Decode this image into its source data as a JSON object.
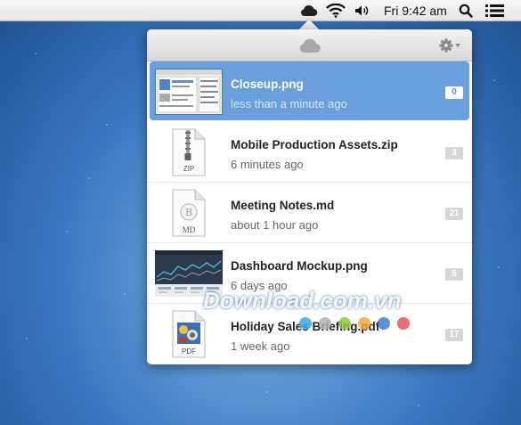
{
  "menubar": {
    "clock": "Fri 9:42 am",
    "icons": [
      "cloud-icon",
      "wifi-icon",
      "volume-icon",
      "search-icon",
      "list-icon"
    ]
  },
  "popover": {
    "header_icons": [
      "cloud-icon",
      "gear-icon"
    ],
    "files": [
      {
        "name": "Closeup.png",
        "time": "less than a minute ago",
        "count": "0",
        "selected": true,
        "thumb": "screenshot"
      },
      {
        "name": "Mobile Production Assets.zip",
        "time": "6 minutes ago",
        "count": "3",
        "selected": false,
        "thumb": "zip-file-icon",
        "type_label": "ZIP"
      },
      {
        "name": "Meeting Notes.md",
        "time": "about 1 hour ago",
        "count": "21",
        "selected": false,
        "thumb": "markdown-file-icon",
        "type_label": "MD"
      },
      {
        "name": "Dashboard Mockup.png",
        "time": "6 days ago",
        "count": "5",
        "selected": false,
        "thumb": "dashboard-image"
      },
      {
        "name": "Holiday Sales Briefing.pdf",
        "time": "1 week ago",
        "count": "17",
        "selected": false,
        "thumb": "pdf-file-icon",
        "type_label": "PDF"
      }
    ]
  },
  "watermark": {
    "text": "Download.com.vn",
    "dot_colors": [
      "#3aa6e8",
      "#b0b0b0",
      "#8cc63e",
      "#f4a53a",
      "#3a7fd8",
      "#e8505b"
    ]
  },
  "colors": {
    "selection": "#6a9fdd",
    "badge": "#d6d6d6"
  }
}
